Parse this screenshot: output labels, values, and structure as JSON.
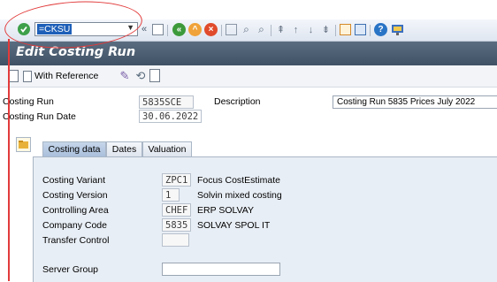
{
  "command_field": {
    "value": "=CKSU"
  },
  "page": {
    "title": "Edit Costing Run"
  },
  "app_toolbar": {
    "with_reference_label": "With Reference"
  },
  "header": {
    "costing_run_label": "Costing Run",
    "costing_run_value": "5835SCE",
    "description_label": "Description",
    "description_value": "Costing Run 5835 Prices July 2022",
    "costing_run_date_label": "Costing Run Date",
    "costing_run_date_value": "30.06.2022"
  },
  "tabs": [
    {
      "label": "Costing data",
      "active": true
    },
    {
      "label": "Dates",
      "active": false
    },
    {
      "label": "Valuation",
      "active": false
    }
  ],
  "costing_data": {
    "costing_variant_label": "Costing Variant",
    "costing_variant_value": "ZPC1",
    "costing_variant_text": "Focus CostEstimate",
    "costing_version_label": "Costing Version",
    "costing_version_value": "1",
    "costing_version_text": "Solvin mixed costing",
    "controlling_area_label": "Controlling Area",
    "controlling_area_value": "CHEF",
    "controlling_area_text": "ERP SOLVAY",
    "company_code_label": "Company Code",
    "company_code_value": "5835",
    "company_code_text": "SOLVAY SPOL IT",
    "transfer_control_label": "Transfer Control",
    "transfer_control_value": "",
    "server_group_label": "Server Group",
    "server_group_value": ""
  },
  "colors": {
    "title_bar": "#4a5c6f",
    "annotation": "#e23a3a",
    "selection": "#1d5fb8"
  }
}
